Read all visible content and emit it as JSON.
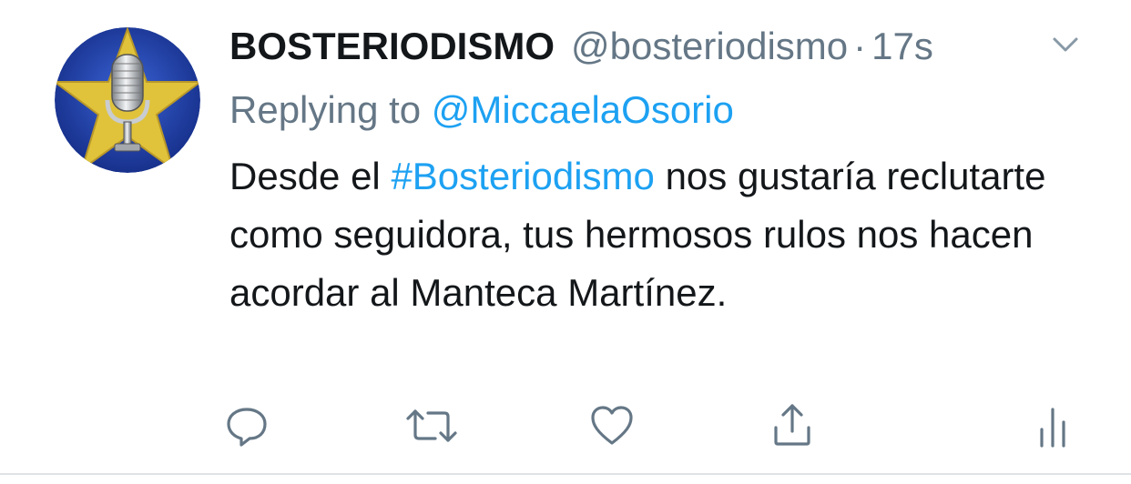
{
  "tweet": {
    "author_name": "BOSTERIODISMO",
    "author_handle": "@bosteriodismo",
    "separator": "·",
    "timestamp": "17s",
    "replying_prefix": "Replying to",
    "replying_to": "@MiccaelaOsorio",
    "text_before": "Desde el ",
    "hashtag": "#Bosteriodismo",
    "text_after": " nos gustaría reclutarte como seguidora, tus hermosos rulos nos hacen acordar al Manteca Martínez."
  },
  "icons": {
    "caret": "chevron-down-icon",
    "reply": "reply-icon",
    "retweet": "retweet-icon",
    "like": "heart-icon",
    "share": "share-icon",
    "analytics": "analytics-icon"
  },
  "colors": {
    "link": "#1da1f2",
    "secondary_text": "#657786",
    "primary_text": "#14171a",
    "avatar_bg": "#1f3fa6",
    "avatar_star": "#e0c33a"
  }
}
